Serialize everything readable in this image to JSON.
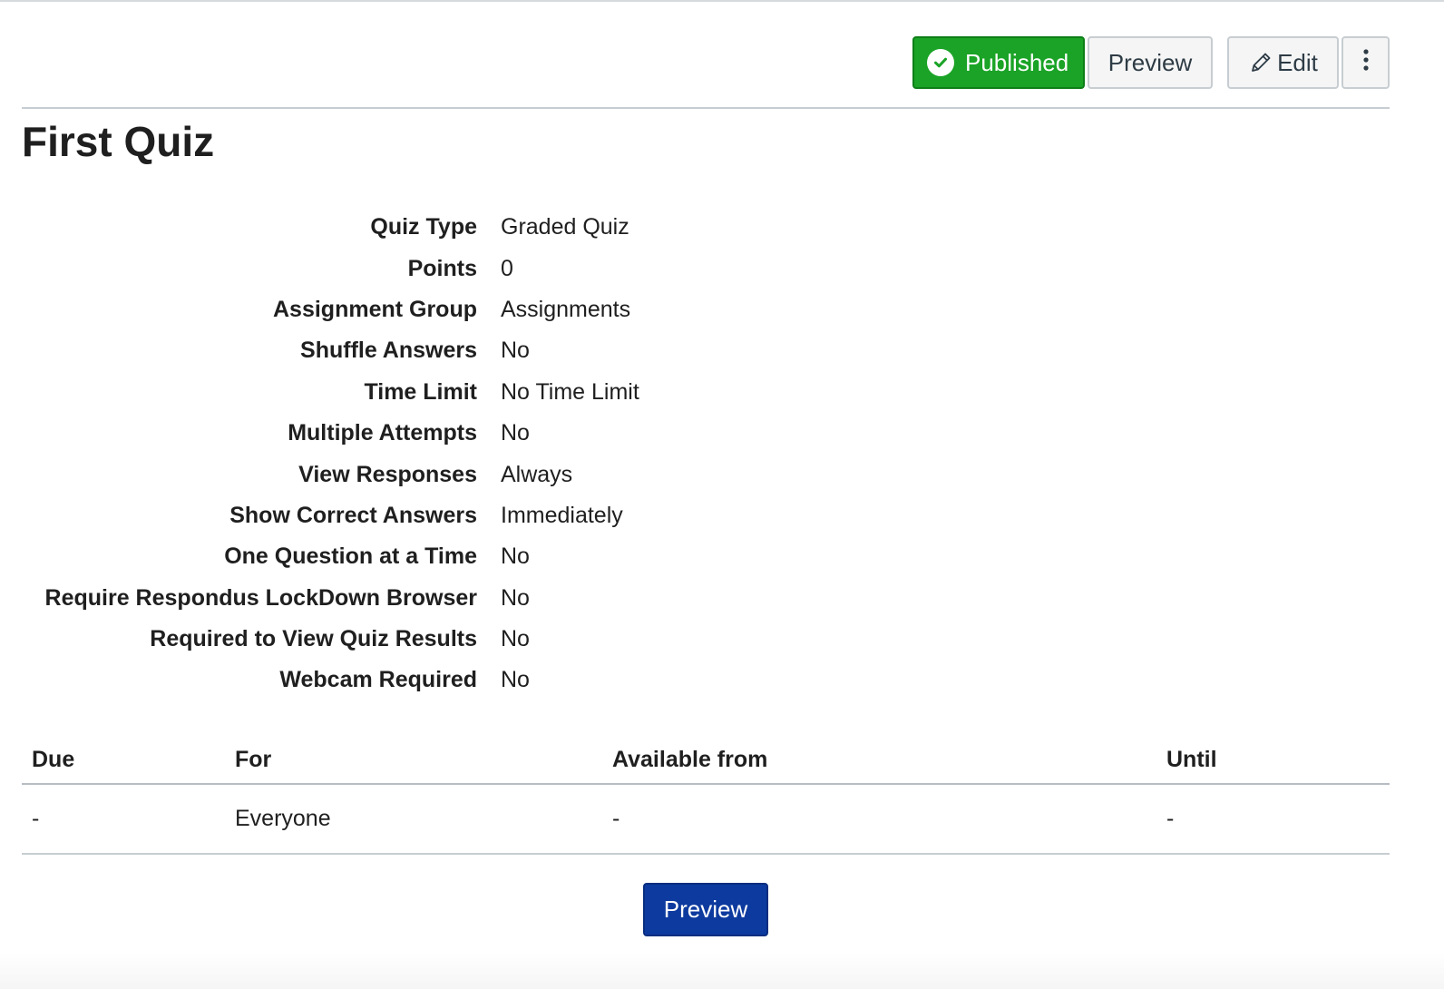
{
  "toolbar": {
    "published_label": "Published",
    "preview_label": "Preview",
    "edit_label": "Edit"
  },
  "quiz": {
    "title": "First Quiz",
    "details": [
      {
        "label": "Quiz Type",
        "value": "Graded Quiz"
      },
      {
        "label": "Points",
        "value": "0"
      },
      {
        "label": "Assignment Group",
        "value": "Assignments"
      },
      {
        "label": "Shuffle Answers",
        "value": "No"
      },
      {
        "label": "Time Limit",
        "value": "No Time Limit"
      },
      {
        "label": "Multiple Attempts",
        "value": "No"
      },
      {
        "label": "View Responses",
        "value": "Always"
      },
      {
        "label": "Show Correct Answers",
        "value": "Immediately"
      },
      {
        "label": "One Question at a Time",
        "value": "No"
      },
      {
        "label": "Require Respondus LockDown Browser",
        "value": "No"
      },
      {
        "label": "Required to View Quiz Results",
        "value": "No"
      },
      {
        "label": "Webcam Required",
        "value": "No"
      }
    ]
  },
  "dates_table": {
    "headers": {
      "due": "Due",
      "for": "For",
      "available_from": "Available from",
      "until": "Until"
    },
    "rows": [
      {
        "due": "-",
        "for": "Everyone",
        "available_from": "-",
        "until": "-"
      }
    ]
  },
  "footer": {
    "preview_label": "Preview"
  },
  "icons": {
    "published": "check-circle-icon",
    "edit": "pencil-icon",
    "more": "kebab-menu-icon"
  },
  "colors": {
    "published_bg": "#1aa326",
    "primary_button_bg": "#0d3a9e"
  }
}
